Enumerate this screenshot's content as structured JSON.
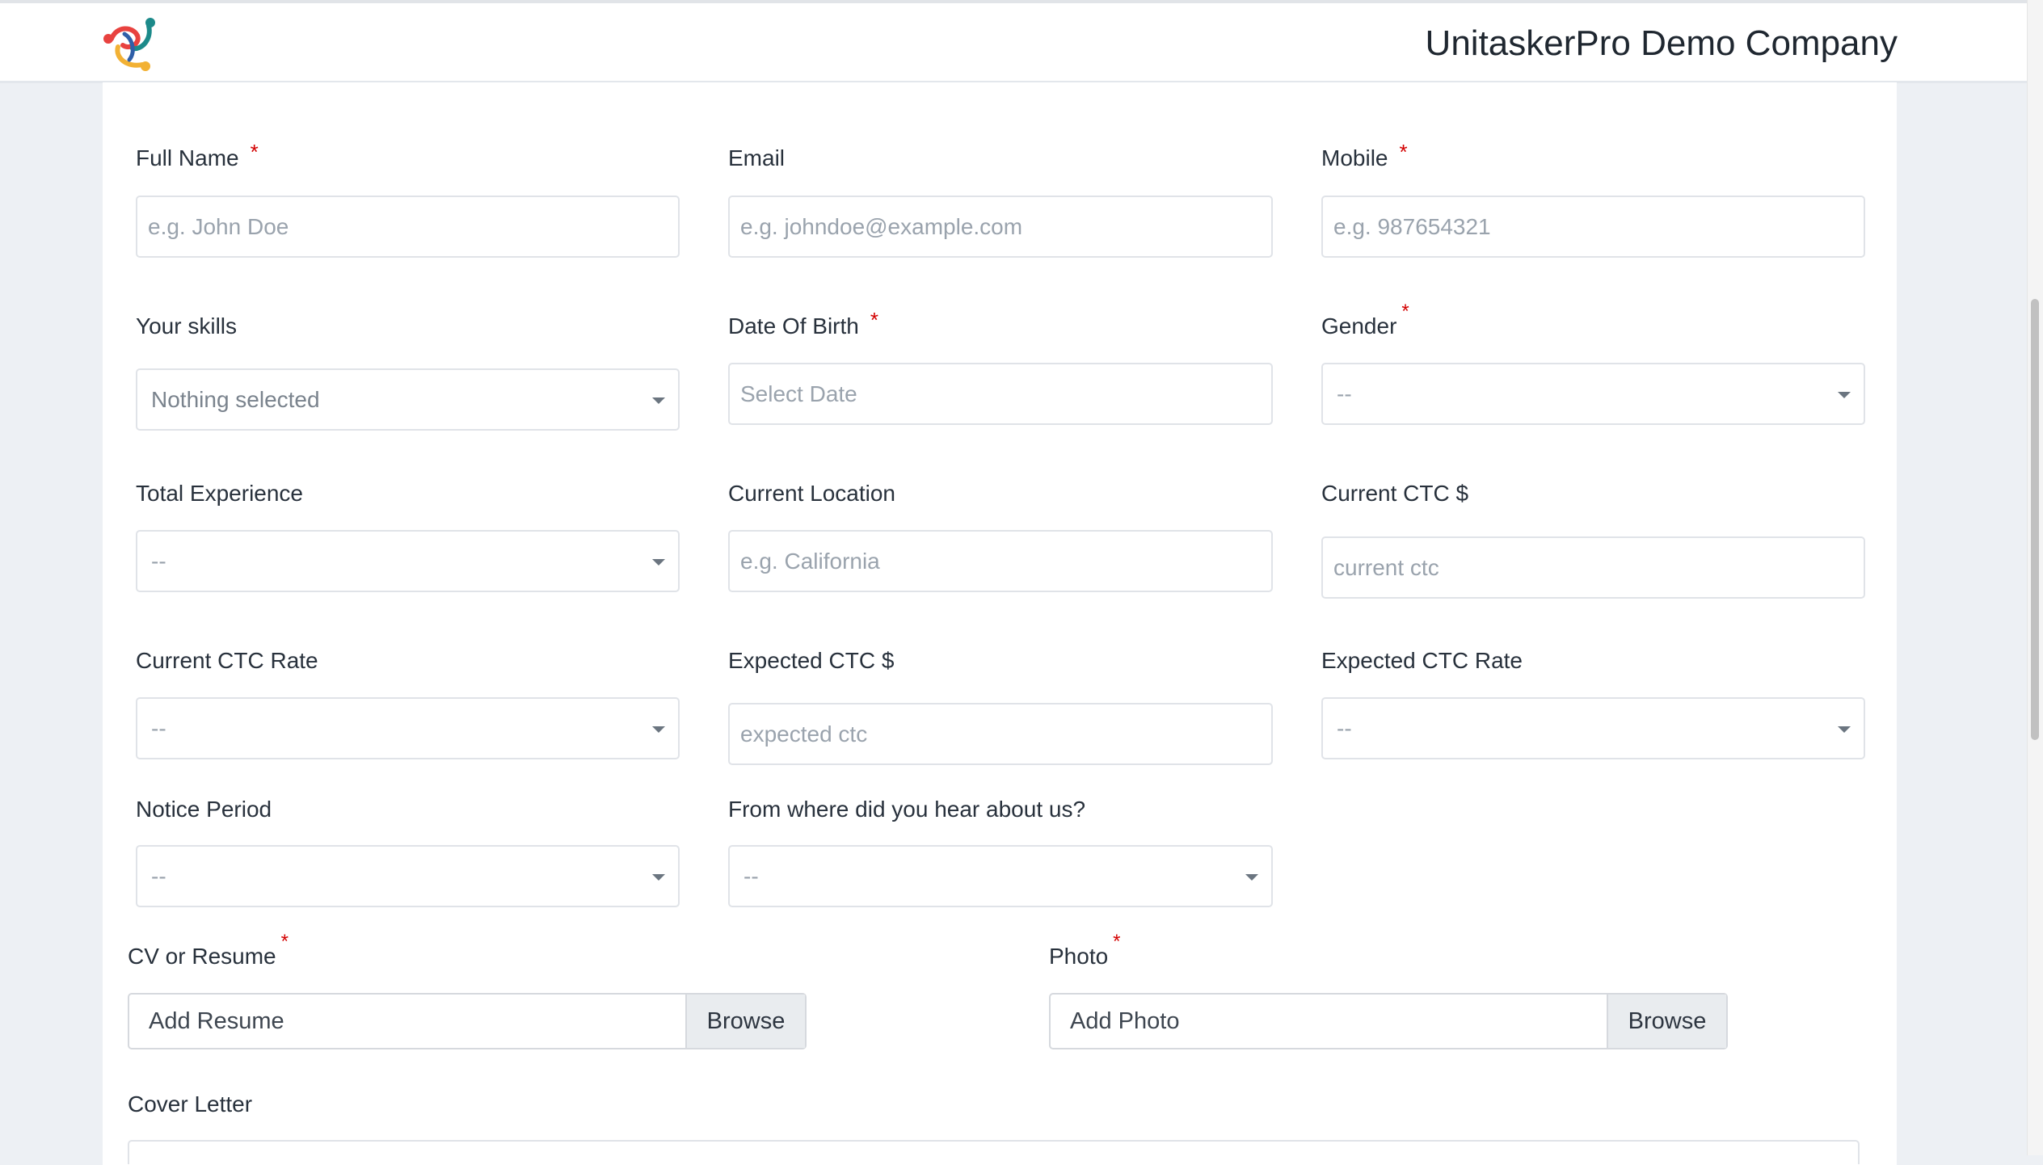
{
  "header": {
    "company_name": "UnitaskerPro Demo Company"
  },
  "form": {
    "full_name": {
      "label": "Full Name",
      "required": "*",
      "placeholder": "e.g. John Doe"
    },
    "email": {
      "label": "Email",
      "placeholder": "e.g. johndoe@example.com"
    },
    "mobile": {
      "label": "Mobile",
      "required": "*",
      "placeholder": "e.g. 987654321"
    },
    "skills": {
      "label": "Your skills",
      "selected": "Nothing selected"
    },
    "dob": {
      "label": "Date Of Birth",
      "required": "*",
      "placeholder": "Select Date"
    },
    "gender": {
      "label": "Gender",
      "required": "*",
      "selected": "--"
    },
    "total_experience": {
      "label": "Total Experience",
      "selected": "--"
    },
    "current_location": {
      "label": "Current Location",
      "placeholder": "e.g. California"
    },
    "current_ctc": {
      "label": "Current CTC $",
      "placeholder": "current ctc"
    },
    "current_ctc_rate": {
      "label": "Current CTC Rate",
      "selected": "--"
    },
    "expected_ctc": {
      "label": "Expected CTC $",
      "placeholder": "expected ctc"
    },
    "expected_ctc_rate": {
      "label": "Expected CTC Rate",
      "selected": "--"
    },
    "notice_period": {
      "label": "Notice Period",
      "selected": "--"
    },
    "source": {
      "label": "From where did you hear about us?",
      "selected": "--"
    },
    "resume": {
      "label": "CV or Resume",
      "required": "*",
      "file_text": "Add Resume",
      "button": "Browse"
    },
    "photo": {
      "label": "Photo",
      "required": "*",
      "file_text": "Add Photo",
      "button": "Browse"
    },
    "cover_letter": {
      "label": "Cover Letter"
    }
  },
  "colors": {
    "required": "#d30000",
    "page_bg": "#edf0f4",
    "border": "#e0e3e8"
  }
}
